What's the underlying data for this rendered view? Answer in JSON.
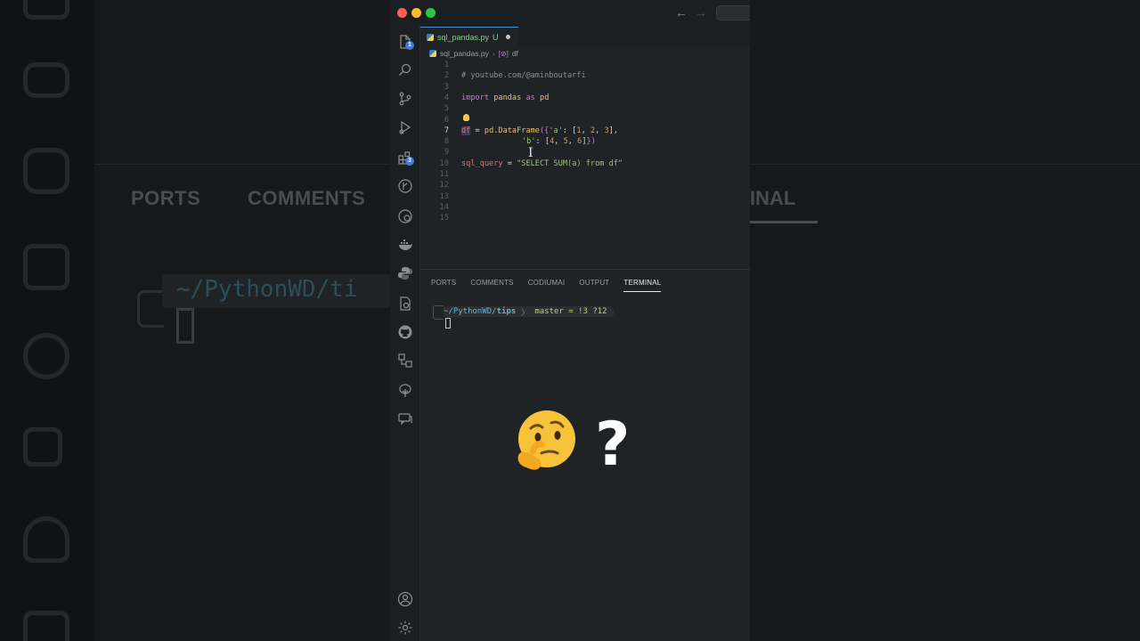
{
  "background": {
    "left_path": "~/PythonWD/ti",
    "left_tabs": [
      "PORTS",
      "COMMENTS"
    ],
    "right_tab": "INAL"
  },
  "window": {
    "colors": {
      "accent": "#3d8fd1",
      "string": "#98c379",
      "keyword": "#c678dd",
      "variable": "#e06c75",
      "number": "#d19a66"
    }
  },
  "activity_bar": {
    "icons": [
      "files-icon",
      "search-icon",
      "source-control-icon",
      "run-debug-icon",
      "extensions-icon",
      "git-graph-icon",
      "remote-explorer-icon",
      "docker-icon",
      "python-icon",
      "testing-icon",
      "github-icon",
      "connections-icon",
      "tree-icon",
      "chat-icon",
      "account-icon",
      "settings-gear-icon"
    ],
    "files_badge": "1",
    "extensions_badge": "3"
  },
  "tab": {
    "filename": "sql_pandas.py",
    "status": "U"
  },
  "breadcrumb": {
    "file": "sql_pandas.py",
    "symbol_icon": "[⊘]",
    "symbol": "df"
  },
  "editor": {
    "line_numbers": [
      "1",
      "2",
      "3",
      "4",
      "5",
      "6",
      "7",
      "8",
      "9",
      "10",
      "11",
      "12",
      "13",
      "14",
      "15"
    ],
    "active_line": "7",
    "comment": "# youtube.com/@aminboutarfi",
    "import_kw": "import",
    "import_mod": "pandas",
    "as_kw": "as",
    "alias": "pd",
    "df_var": "df",
    "assign": " = ",
    "df_call": "pd.DataFrame",
    "open": "({",
    "key_a": "'a'",
    "vals_a_open": ": [",
    "a1": "1",
    "a2": "2",
    "a3": "3",
    "vals_close": "],",
    "key_b": "'b'",
    "b1": "4",
    "b2": "5",
    "b3": "6",
    "close_b": "]",
    "close_all": "})",
    "query_var": "sql_query",
    "query_str": "\"SELECT SUM(a) from df\""
  },
  "panel": {
    "tabs": [
      "PORTS",
      "COMMENTS",
      "CODIUMAI",
      "OUTPUT",
      "TERMINAL"
    ],
    "active_tab": "TERMINAL"
  },
  "terminal": {
    "path_prefix": "~/PythonWD/",
    "path_bold": "tips",
    "separator": "〉",
    "git_status": "master = !3 ?12"
  },
  "overlay": {
    "emoji": "thinking-face",
    "question": "?"
  }
}
